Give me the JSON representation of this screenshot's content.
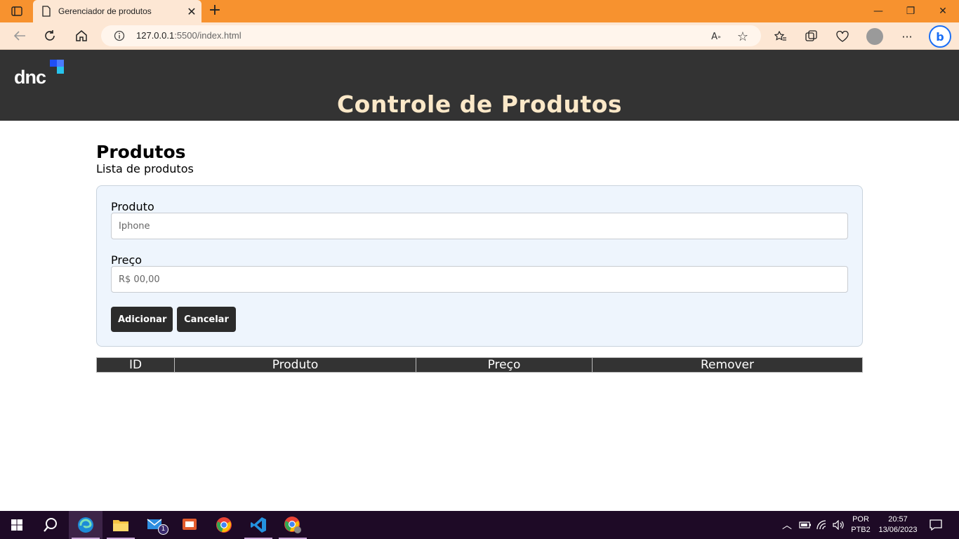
{
  "browser": {
    "tab_title": "Gerenciador de produtos",
    "url_host": "127.0.0.1",
    "url_rest": ":5500/index.html"
  },
  "header": {
    "logo_text": "dnc",
    "title": "Controle de Produtos"
  },
  "section": {
    "title": "Produtos",
    "subtitle": "Lista de produtos"
  },
  "form": {
    "product_label": "Produto",
    "product_placeholder": "Iphone",
    "price_label": "Preço",
    "price_placeholder": "R$ 00,00",
    "add_button": "Adicionar",
    "cancel_button": "Cancelar"
  },
  "table": {
    "columns": [
      "ID",
      "Produto",
      "Preço",
      "Remover"
    ]
  },
  "taskbar": {
    "mail_badge": "1",
    "lang_top": "POR",
    "lang_bottom": "PTB2",
    "time": "20:57",
    "date": "13/06/2023"
  },
  "colors": {
    "tabbar": "#f7922f",
    "header_bg": "#333333",
    "title_color": "#fbe8c8",
    "card_bg": "#eef5fd"
  }
}
